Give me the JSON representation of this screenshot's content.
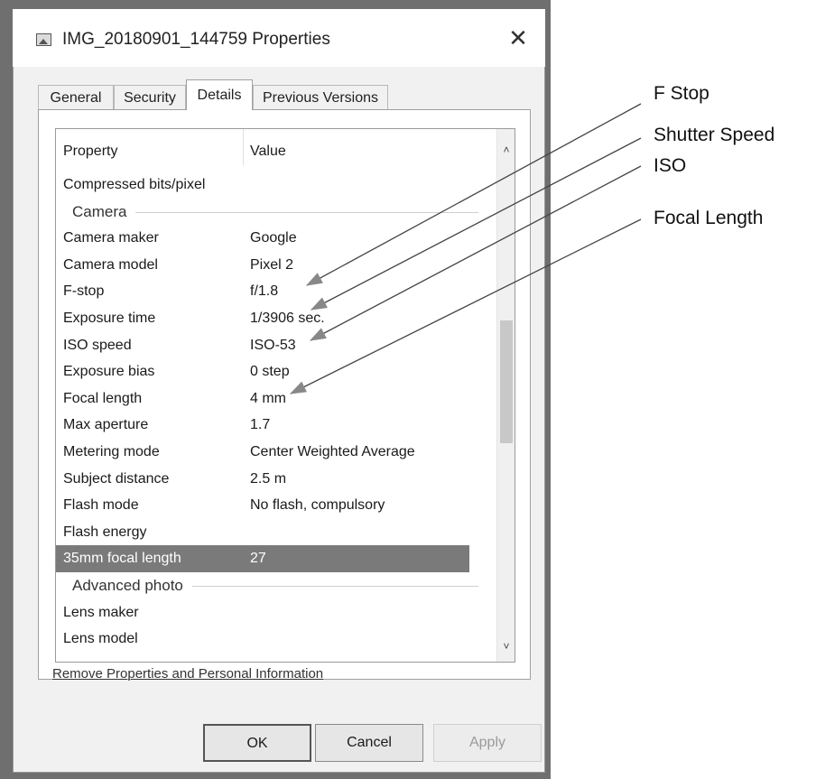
{
  "window": {
    "title": "IMG_20180901_144759 Properties",
    "close_glyph": "✕",
    "icon": "image-file-icon"
  },
  "tabs": [
    {
      "label": "General",
      "active": false
    },
    {
      "label": "Security",
      "active": false
    },
    {
      "label": "Details",
      "active": true
    },
    {
      "label": "Previous Versions",
      "active": false
    }
  ],
  "list": {
    "headers": {
      "property": "Property",
      "value": "Value"
    },
    "rows": [
      {
        "property": "Compressed bits/pixel",
        "value": ""
      },
      {
        "group": "Camera"
      },
      {
        "property": "Camera maker",
        "value": "Google"
      },
      {
        "property": "Camera model",
        "value": "Pixel 2"
      },
      {
        "property": "F-stop",
        "value": "f/1.8"
      },
      {
        "property": "Exposure time",
        "value": "1/3906 sec."
      },
      {
        "property": "ISO speed",
        "value": "ISO-53"
      },
      {
        "property": "Exposure bias",
        "value": "0 step"
      },
      {
        "property": "Focal length",
        "value": "4 mm"
      },
      {
        "property": "Max aperture",
        "value": "1.7"
      },
      {
        "property": "Metering mode",
        "value": "Center Weighted Average"
      },
      {
        "property": "Subject distance",
        "value": "2.5 m"
      },
      {
        "property": "Flash mode",
        "value": "No flash, compulsory"
      },
      {
        "property": "Flash energy",
        "value": ""
      },
      {
        "property": "35mm focal length",
        "value": "27",
        "selected": true
      },
      {
        "group": "Advanced photo"
      },
      {
        "property": "Lens maker",
        "value": ""
      },
      {
        "property": "Lens model",
        "value": ""
      }
    ],
    "scroll_up_glyph": "˄",
    "scroll_down_glyph": "˅"
  },
  "remove_link": "Remove Properties and Personal Information",
  "buttons": {
    "ok": "OK",
    "cancel": "Cancel",
    "apply": "Apply"
  },
  "callouts": [
    {
      "label": "F Stop",
      "target_row": "F-stop"
    },
    {
      "label": "Shutter Speed",
      "target_row": "Exposure time"
    },
    {
      "label": "ISO",
      "target_row": "ISO speed"
    },
    {
      "label": "Focal Length",
      "target_row": "Focal length"
    }
  ]
}
